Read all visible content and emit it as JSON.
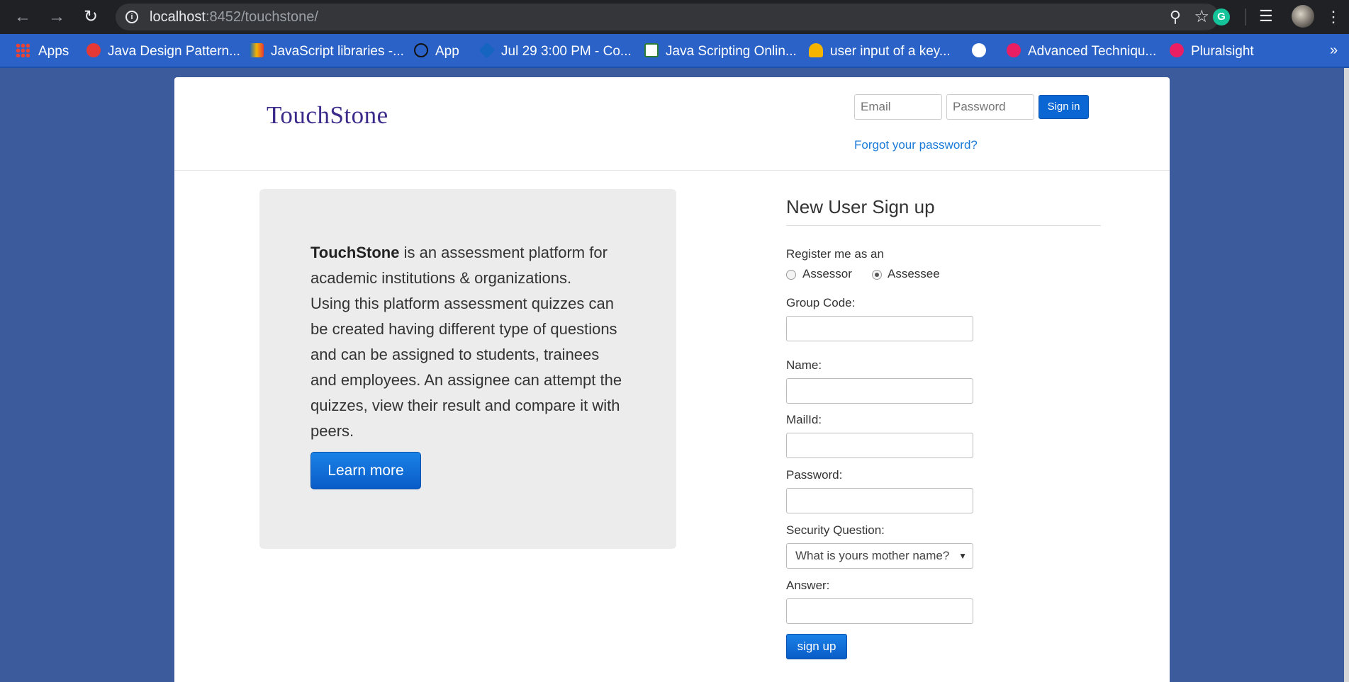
{
  "browser": {
    "url_host": "localhost",
    "url_rest": ":8452/touchstone/",
    "profile_initial": "G"
  },
  "bookmarks": [
    {
      "label": "Apps",
      "color": "#ea4335"
    },
    {
      "label": "Java Design Pattern...",
      "color": "#e53935"
    },
    {
      "label": "JavaScript libraries -...",
      "color": "#f4b400"
    },
    {
      "label": "App",
      "color": "#ffffff"
    },
    {
      "label": "Jul 29 3:00 PM - Co...",
      "color": "#1565c0"
    },
    {
      "label": "Java Scripting Onlin...",
      "color": "#2e7d32"
    },
    {
      "label": "user input of a key...",
      "color": "#f4b400"
    },
    {
      "label": "",
      "color": "#ffffff"
    },
    {
      "label": "Advanced Techniqu...",
      "color": "#e91e63"
    },
    {
      "label": "Pluralsight",
      "color": "#e91e63"
    }
  ],
  "header": {
    "logo": "TouchStone",
    "email_placeholder": "Email",
    "password_placeholder": "Password",
    "signin_label": "Sign in",
    "forgot_label": "Forgot your password?"
  },
  "info": {
    "brand": "TouchStone",
    "text_part1": " is an assessment platform for academic institutions & organizations.",
    "text_part2": "Using this platform assessment quizzes can be created having different type of questions and can be assigned to students, trainees and employees. An assignee can attempt the quizzes, view their result and compare it with peers.",
    "learn_more": "Learn more"
  },
  "signup": {
    "title": "New User Sign up",
    "register_label": "Register me as an",
    "option_assessor": "Assessor",
    "option_assessee": "Assessee",
    "selected_role": "Assessee",
    "group_code_label": "Group Code:",
    "name_label": "Name:",
    "mail_label": "MailId:",
    "password_label": "Password:",
    "security_label": "Security Question:",
    "security_selected": "What is yours mother name?",
    "answer_label": "Answer:",
    "submit_label": "sign up"
  }
}
